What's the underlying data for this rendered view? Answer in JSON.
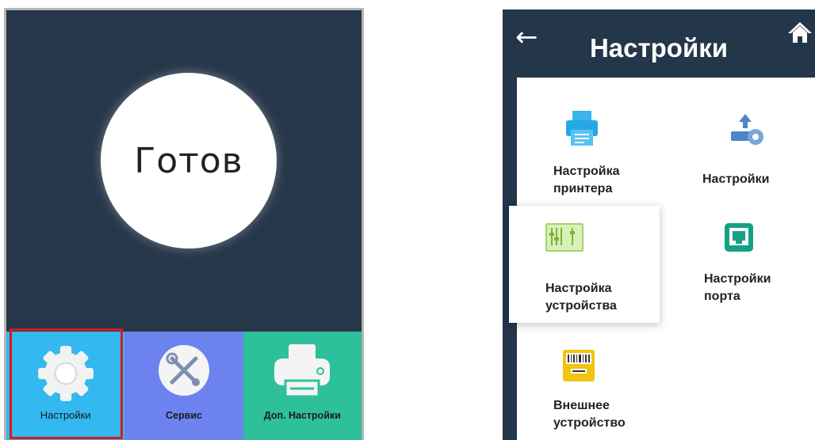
{
  "left_screen": {
    "status": "Готов",
    "tiles": [
      {
        "label": "Настройки",
        "icon": "gear-icon",
        "color": "#33b8ef"
      },
      {
        "label": "Сервис",
        "icon": "tools-icon",
        "color": "#6b82ef"
      },
      {
        "label": "Доп. Настройки",
        "icon": "printer-icon",
        "color": "#2ec09a"
      }
    ]
  },
  "right_screen": {
    "title": "Настройки",
    "items": [
      {
        "line1": "Настройка",
        "line2": "принтера",
        "icon": "printer-icon"
      },
      {
        "line1": "Настройки",
        "line2": "",
        "icon": "upload-settings-icon"
      },
      {
        "line1": "Настройка",
        "line2": "устройства",
        "icon": "device-settings-icon"
      },
      {
        "line1": "Настройки",
        "line2": "порта",
        "icon": "network-port-icon"
      },
      {
        "line1": "Внешнее",
        "line2": "устройство",
        "icon": "barcode-scanner-icon"
      }
    ]
  },
  "colors": {
    "screen_bg": "#26374a",
    "highlight": "#e0161b"
  }
}
